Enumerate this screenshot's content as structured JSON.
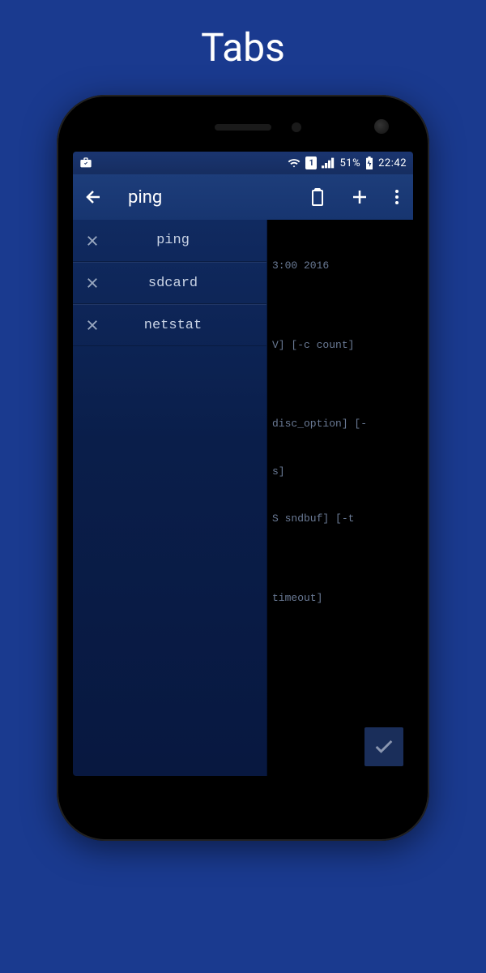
{
  "page_title": "Tabs",
  "statusbar": {
    "battery": "51%",
    "time": "22:42",
    "sim": "1"
  },
  "actionbar": {
    "title": "ping"
  },
  "tabs": [
    {
      "label": "ping"
    },
    {
      "label": "sdcard"
    },
    {
      "label": "netstat"
    }
  ],
  "terminal": {
    "lines": [
      "3:00 2016",
      "",
      "V] [-c count]",
      "",
      "disc_option] [-",
      "s]",
      "S sndbuf] [-t",
      "",
      "timeout]"
    ]
  }
}
